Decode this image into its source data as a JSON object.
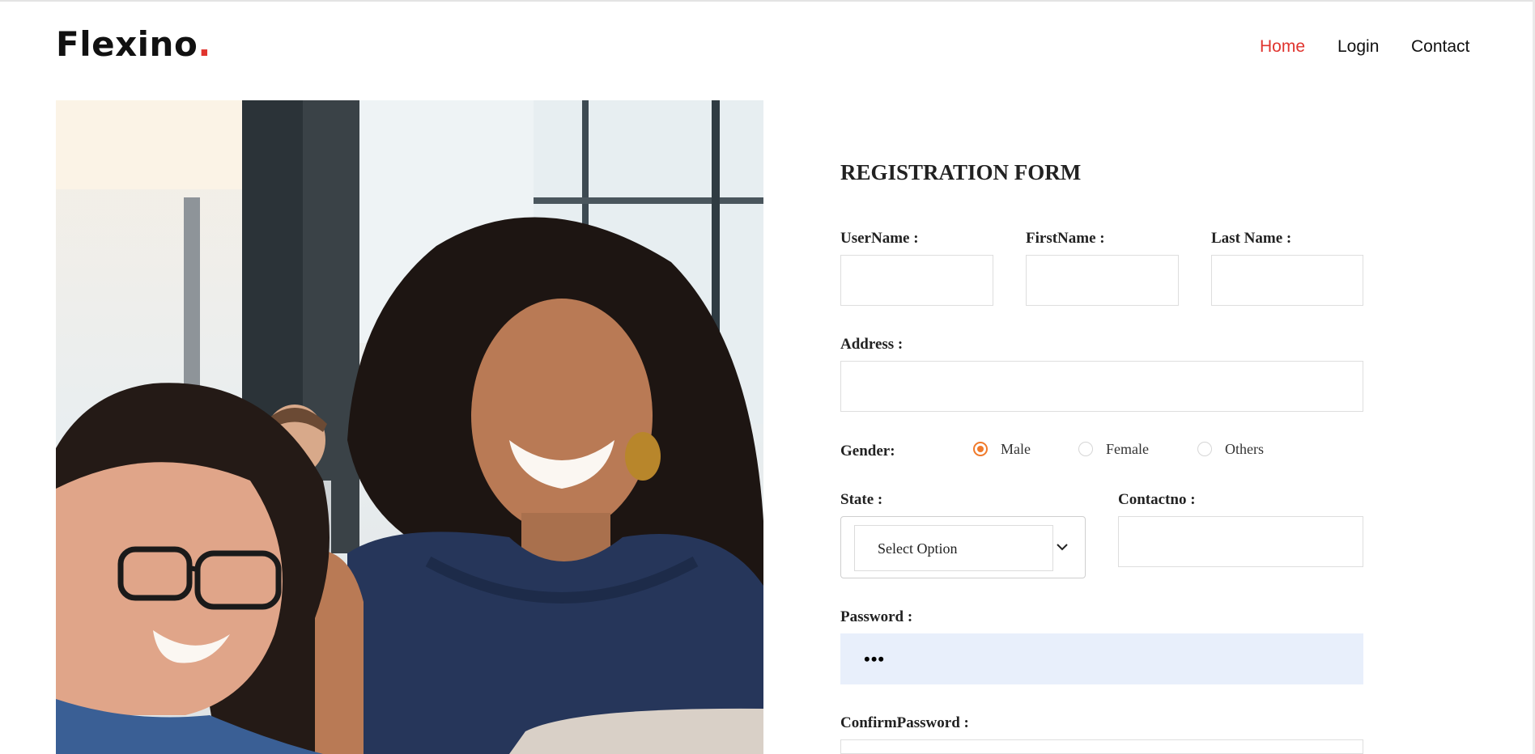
{
  "brand": {
    "name": "Flexino",
    "dot": ".",
    "dot_color": "#e0342e"
  },
  "nav": {
    "items": [
      {
        "label": "Home",
        "active": true
      },
      {
        "label": "Login",
        "active": false
      },
      {
        "label": "Contact",
        "active": false
      }
    ]
  },
  "hero_image": {
    "description_icon": "photo-teacher-student"
  },
  "form": {
    "title": "REGISTRATION FORM",
    "username_label": "UserName :",
    "firstname_label": "FirstName :",
    "lastname_label": "Last Name :",
    "address_label": "Address :",
    "gender_label": "Gender:",
    "gender_options": [
      {
        "label": "Male",
        "checked": true
      },
      {
        "label": "Female",
        "checked": false
      },
      {
        "label": "Others",
        "checked": false
      }
    ],
    "state_label": "State :",
    "state_selected": "Select Option",
    "contact_label": "Contactno :",
    "password_label": "Password :",
    "password_value": "•••",
    "confirm_password_label": "ConfirmPassword :",
    "accent_color": "#f07a2b",
    "autofill_color": "#e8effb"
  }
}
